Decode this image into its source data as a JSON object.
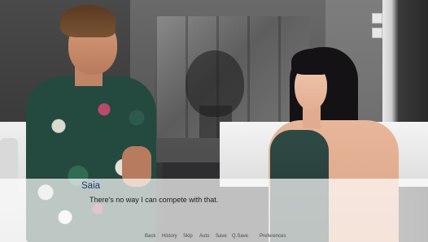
{
  "dialogue": {
    "speaker": "Saia",
    "text": "There's no way I can compete with that."
  },
  "quick_menu": {
    "back": "Back",
    "history": "History",
    "skip": "Skip",
    "auto": "Auto",
    "save": "Save",
    "qsave": "Q.Save",
    "preferences": "Preferences"
  },
  "colors": {
    "speaker_name": "#1f3a72",
    "dialogue_text": "#1d1d1d",
    "quick_menu_text": "#4a4a4a"
  }
}
